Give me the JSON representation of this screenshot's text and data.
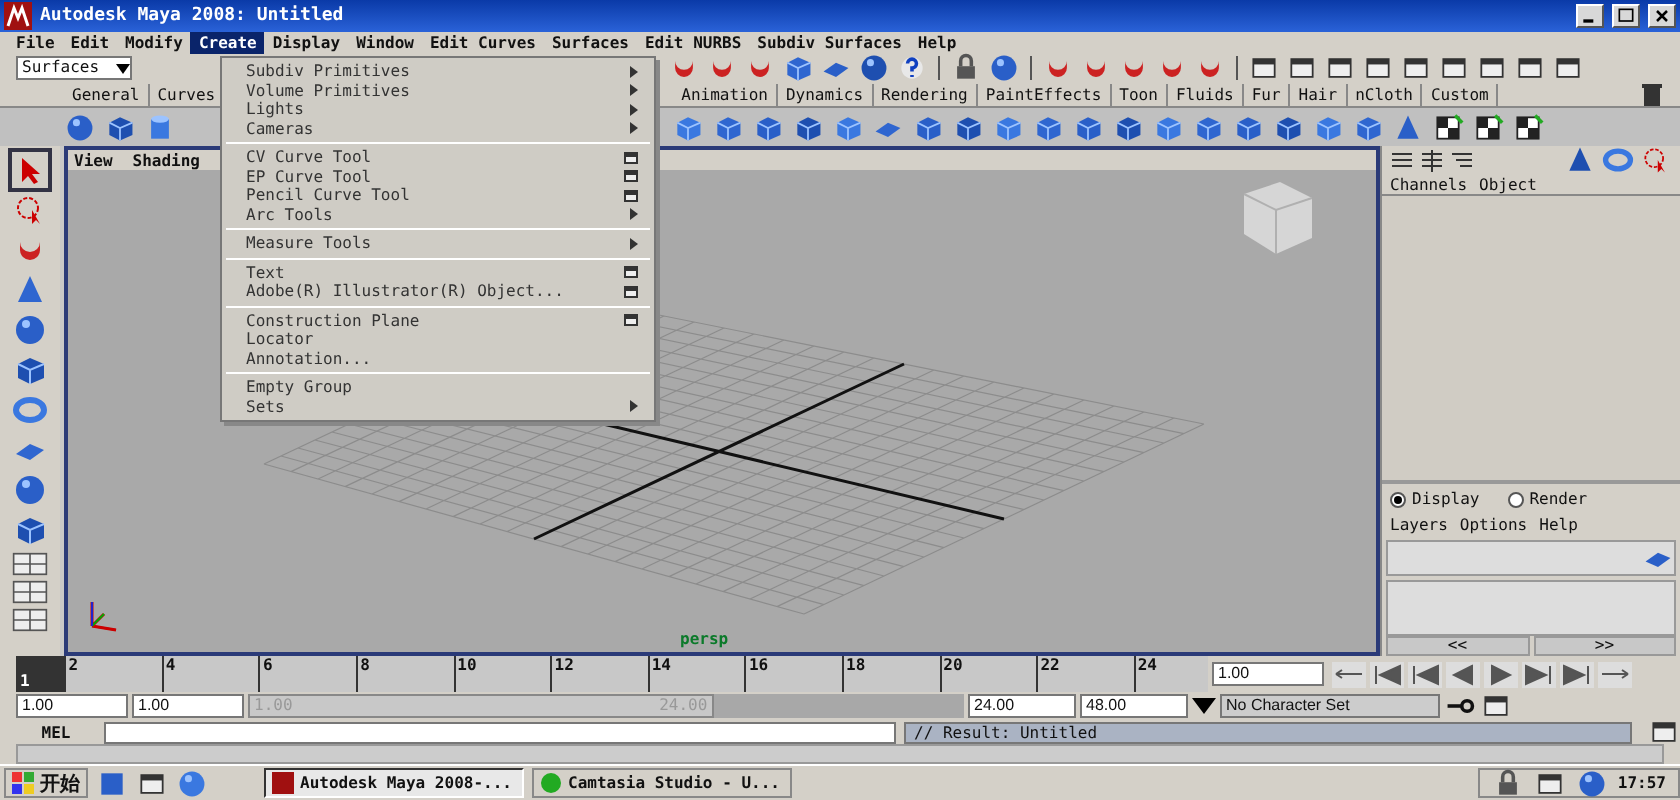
{
  "window": {
    "title": "Autodesk Maya 2008: Untitled"
  },
  "menu_bar": [
    {
      "label": "File",
      "selected": false
    },
    {
      "label": "Edit",
      "selected": false
    },
    {
      "label": "Modify",
      "selected": false
    },
    {
      "label": "Create",
      "selected": true
    },
    {
      "label": "Display",
      "selected": false
    },
    {
      "label": "Window",
      "selected": false
    },
    {
      "label": "Edit Curves",
      "selected": false
    },
    {
      "label": "Surfaces",
      "selected": false
    },
    {
      "label": "Edit NURBS",
      "selected": false
    },
    {
      "label": "Subdiv Surfaces",
      "selected": false
    },
    {
      "label": "Help",
      "selected": false
    }
  ],
  "status_line": {
    "mode": "Surfaces"
  },
  "shelf_tabs": [
    {
      "label": "General",
      "selected": false
    },
    {
      "label": "Curves",
      "selected": false
    },
    {
      "label": "Animation",
      "selected": false
    },
    {
      "label": "Dynamics",
      "selected": false
    },
    {
      "label": "Rendering",
      "selected": false
    },
    {
      "label": "PaintEffects",
      "selected": false
    },
    {
      "label": "Toon",
      "selected": false
    },
    {
      "label": "Fluids",
      "selected": false
    },
    {
      "label": "Fur",
      "selected": false
    },
    {
      "label": "Hair",
      "selected": false
    },
    {
      "label": "nCloth",
      "selected": false
    },
    {
      "label": "Custom",
      "selected": false
    }
  ],
  "create_menu": {
    "items": [
      {
        "kind": "submenu",
        "label": "Subdiv Primitives"
      },
      {
        "kind": "submenu",
        "label": "Volume Primitives"
      },
      {
        "kind": "submenu",
        "label": "Lights"
      },
      {
        "kind": "submenu",
        "label": "Cameras"
      },
      {
        "kind": "separator"
      },
      {
        "kind": "option",
        "label": "CV Curve Tool"
      },
      {
        "kind": "option",
        "label": "EP Curve Tool"
      },
      {
        "kind": "option",
        "label": "Pencil Curve Tool"
      },
      {
        "kind": "submenu",
        "label": "Arc Tools"
      },
      {
        "kind": "separator"
      },
      {
        "kind": "submenu",
        "label": "Measure Tools"
      },
      {
        "kind": "separator"
      },
      {
        "kind": "option",
        "label": "Text"
      },
      {
        "kind": "option",
        "label": "Adobe(R) Illustrator(R) Object..."
      },
      {
        "kind": "separator"
      },
      {
        "kind": "option",
        "label": "Construction Plane"
      },
      {
        "kind": "item",
        "label": "Locator"
      },
      {
        "kind": "item",
        "label": "Annotation..."
      },
      {
        "kind": "separator"
      },
      {
        "kind": "item",
        "label": "Empty Group"
      },
      {
        "kind": "submenu",
        "label": "Sets"
      }
    ]
  },
  "viewport": {
    "menus": [
      "View",
      "Shading"
    ],
    "camera_label": "persp"
  },
  "channel_box": {
    "tabs": [
      "Channels",
      "Object"
    ]
  },
  "layer_editor": {
    "modes": [
      {
        "label": "Display",
        "selected": true
      },
      {
        "label": "Render",
        "selected": false
      }
    ],
    "menus": [
      "Layers",
      "Options",
      "Help"
    ],
    "nav": [
      "<<",
      ">>"
    ]
  },
  "time_slider": {
    "ticks": [
      "2",
      "4",
      "6",
      "8",
      "10",
      "12",
      "14",
      "16",
      "18",
      "20",
      "22",
      "24"
    ],
    "current_frame": "1",
    "current_time": "1.00",
    "level": 0
  },
  "range_slider": {
    "start_time": "1.00",
    "playback_start": "1.00",
    "range_start": "1.00",
    "range_end": "24.00",
    "playback_end": "24.00",
    "end_time": "48.00",
    "character_set": "No Character Set",
    "level": 0.65
  },
  "command_line": {
    "label": "MEL",
    "result": "// Result: Untitled"
  },
  "taskbar": {
    "start": "开始",
    "tasks": [
      {
        "label": "Autodesk Maya 2008-...",
        "selected": true
      },
      {
        "label": "Camtasia Studio - U...",
        "selected": false
      }
    ],
    "clock": "17:57"
  }
}
